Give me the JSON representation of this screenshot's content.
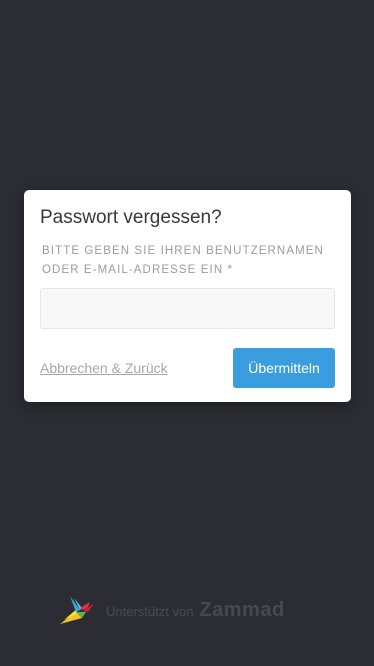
{
  "dialog": {
    "title": "Passwort vergessen?",
    "field_label_line1": "Bitte geben Sie Ihren Benutzernamen",
    "field_label_line2": "oder E-Mail-Adresse ein *",
    "input_value": "",
    "cancel_label": "Abbrechen & Zurück",
    "submit_label": "Übermitteln"
  },
  "footer": {
    "powered_by": "Unterstützt von",
    "brand": "Zammad",
    "logo_icon": "zammad-bird-logo-icon"
  },
  "colors": {
    "background": "#2c2c35",
    "card": "#ffffff",
    "accent": "#3a9ede",
    "input_background": "#f8f8f9"
  }
}
